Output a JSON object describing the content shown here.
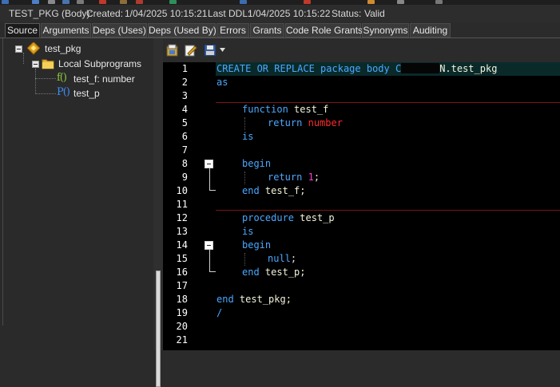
{
  "window": {
    "title": "TEST_PKG (Body):",
    "created_label": "Created:",
    "created_value": "1/04/2025 10:15:21",
    "last_ddl_label": "Last DDL:",
    "last_ddl_value": "1/04/2025 10:15:22",
    "status_label": "Status:",
    "status_value": "Valid"
  },
  "tabs": [
    {
      "label": "Source",
      "active": true
    },
    {
      "label": "Arguments"
    },
    {
      "label": "Deps (Uses)"
    },
    {
      "label": "Deps (Used By)"
    },
    {
      "label": "Errors"
    },
    {
      "label": "Grants"
    },
    {
      "label": "Code Role Grants"
    },
    {
      "label": "Synonyms"
    },
    {
      "label": "Auditing"
    }
  ],
  "tree": {
    "root": {
      "label": "test_pkg",
      "icon": "package-icon"
    },
    "folder": {
      "label": "Local Subprograms",
      "icon": "folder-icon"
    },
    "items": [
      {
        "prefix": "f()",
        "label": "test_f: number",
        "icon": "function-icon"
      },
      {
        "prefix": "P()",
        "label": "test_p",
        "icon": "procedure-icon"
      }
    ]
  },
  "editor_toolbar": {
    "icons": [
      "load-from-database-icon",
      "edit-source-icon",
      "save-options-icon",
      "dropdown-arrow-icon"
    ]
  },
  "editor": {
    "line_numbers": [
      "1",
      "2",
      "3",
      "4",
      "5",
      "6",
      "7",
      "8",
      "9",
      "10",
      "11",
      "12",
      "13",
      "14",
      "15",
      "16",
      "17",
      "18",
      "19",
      "20",
      "21"
    ],
    "line1": {
      "kw": "CREATE OR REPLACE package body C",
      "tail": "N.test_pkg"
    },
    "line2": "as",
    "line4": {
      "kw": "function",
      "name": "test_f"
    },
    "line5": {
      "kw": "return",
      "type": "number"
    },
    "line6": "is",
    "line8": "begin",
    "line9": {
      "kw": "return",
      "num": "1",
      "punct": ";"
    },
    "line10": {
      "kw": "end",
      "name": "test_f;"
    },
    "line12": {
      "kw": "procedure",
      "name": "test_p"
    },
    "line13": "is",
    "line14": "begin",
    "line15": {
      "kw": "null",
      "punct": ";"
    },
    "line16": {
      "kw": "end",
      "name": "test_p;"
    },
    "line18": {
      "kw": "end",
      "name": "test_pkg;"
    },
    "line19": "/"
  },
  "colors": {
    "keyword": "#4aa8ff",
    "identifier": "#f3f3dc",
    "datatype": "#ff2b2b",
    "number": "#ff3fd0",
    "separator": "#7a1414"
  }
}
